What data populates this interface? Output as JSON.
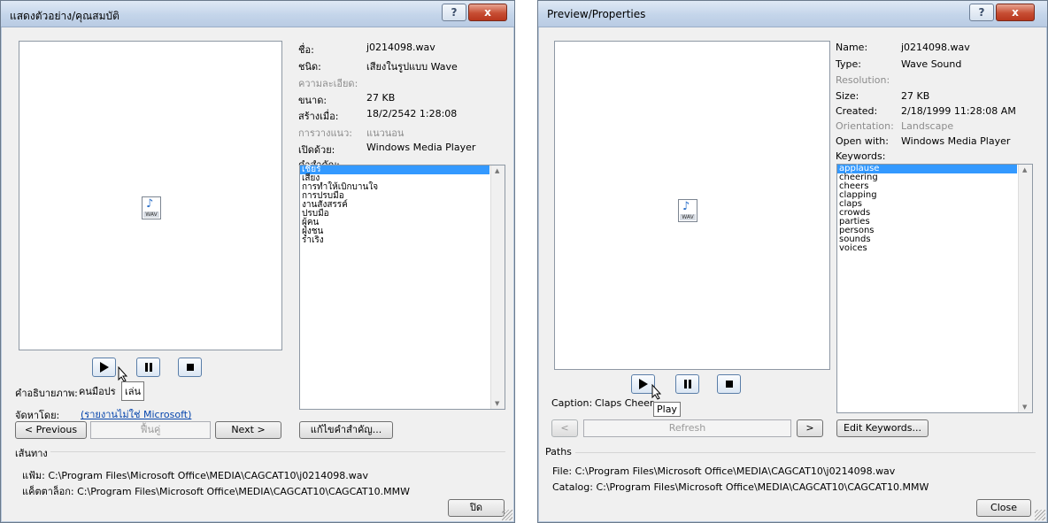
{
  "left": {
    "title": "แสดงตัวอย่าง/คุณสมบัติ",
    "labels": {
      "name": "ชื่อ:",
      "type": "ชนิด:",
      "resolution": "ความละเอียด:",
      "size": "ขนาด:",
      "created": "สร้างเมื่อ:",
      "orientation": "การวางแนว:",
      "open_with": "เปิดด้วย:",
      "keywords": "คำสำคัญ:"
    },
    "values": {
      "name": "j0214098.wav",
      "type": "เสียงในรูปแบบ Wave",
      "size": "27 KB",
      "created": "18/2/2542 1:28:08",
      "orientation": "แนวนอน",
      "open_with": "Windows Media Player"
    },
    "keywords": [
      "เชียร์",
      "เสียง",
      "การทำให้เบิกบานใจ",
      "การปรบมือ",
      "งานสังสรรค์",
      "ปรบมือ",
      "ผู้คน",
      "ฝูงชน",
      "ร่าเริง"
    ],
    "tooltip": "เล่น",
    "caption_label": "คำอธิบายภาพ:",
    "caption_value": "คนมือปร",
    "catalog_label": "จัดหาโดย:",
    "catalog_link": "(รายงานไม่ใช่ Microsoft)",
    "btn_previous": "< Previous",
    "btn_refresh": "ฟื้นคู่",
    "btn_next": "Next >",
    "btn_edit_keywords": "แก้ไขคำสำคัญ...",
    "paths_header": "เส้นทาง",
    "file_path": "แฟ้ม: C:\\Program Files\\Microsoft Office\\MEDIA\\CAGCAT10\\j0214098.wav",
    "catalog_path": "แค็ตตาล็อก: C:\\Program Files\\Microsoft Office\\MEDIA\\CAGCAT10\\CAGCAT10.MMW",
    "btn_close": "ปิด"
  },
  "right": {
    "title": "Preview/Properties",
    "labels": {
      "name": "Name:",
      "type": "Type:",
      "resolution": "Resolution:",
      "size": "Size:",
      "created": "Created:",
      "orientation": "Orientation:",
      "open_with": "Open with:",
      "keywords": "Keywords:"
    },
    "values": {
      "name": "j0214098.wav",
      "type": "Wave Sound",
      "size": "27 KB",
      "created": "2/18/1999 11:28:08 AM",
      "orientation": "Landscape",
      "open_with": "Windows Media Player"
    },
    "keywords": [
      "applause",
      "cheering",
      "cheers",
      "clapping",
      "claps",
      "crowds",
      "parties",
      "persons",
      "sounds",
      "voices"
    ],
    "tooltip": "Play",
    "caption_label": "Caption:",
    "caption_value": "Claps Cheer",
    "btn_previous": "<",
    "btn_refresh": "Refresh",
    "btn_next": ">",
    "btn_edit_keywords": "Edit Keywords...",
    "paths_header": "Paths",
    "file_path": "File: C:\\Program Files\\Microsoft Office\\MEDIA\\CAGCAT10\\j0214098.wav",
    "catalog_path": "Catalog: C:\\Program Files\\Microsoft Office\\MEDIA\\CAGCAT10\\CAGCAT10.MMW",
    "btn_close": "Close"
  },
  "common": {
    "help_glyph": "?",
    "close_glyph": "x",
    "icon_badge": "WAV",
    "icons": [
      "help-icon",
      "close-icon",
      "wav-file-icon",
      "play-icon",
      "pause-icon",
      "stop-icon",
      "mouse-cursor-icon"
    ]
  },
  "colors": {
    "selection": "#3399ff",
    "close_button": "#c74e33",
    "titlebar": "#c4d5ea"
  }
}
